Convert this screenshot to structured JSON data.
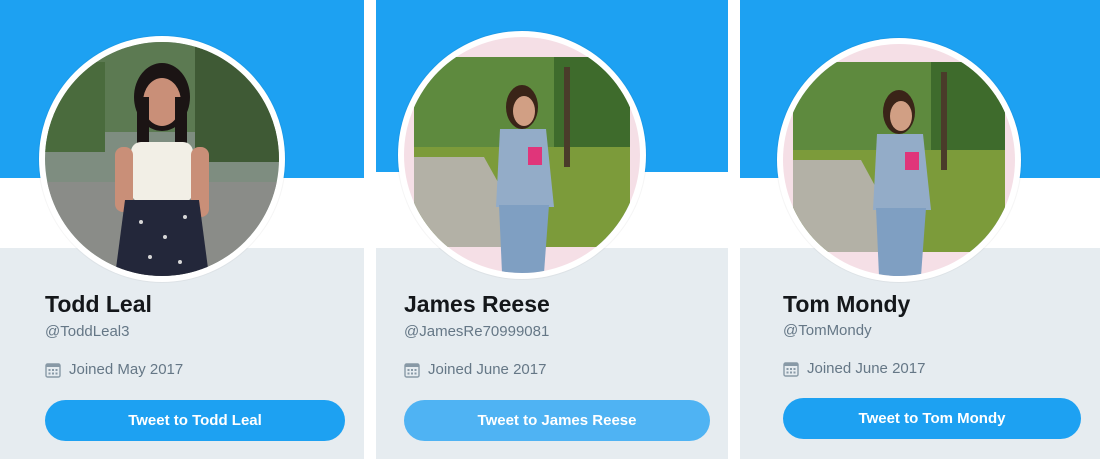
{
  "colors": {
    "banner": "#1da1f2",
    "card_bg": "#e6ecf0",
    "button": "#1da1f2",
    "button_light": "#4fb3f3",
    "name_text": "#14171a",
    "muted_text": "#657786"
  },
  "profiles": [
    {
      "name": "Todd Leal",
      "handle": "@ToddLeal3",
      "joined": "Joined May 2017",
      "joined_icon": "calendar-icon",
      "button_label": "Tweet to Todd Leal"
    },
    {
      "name": "James Reese",
      "handle": "@JamesRe70999081",
      "joined": "Joined June 2017",
      "joined_icon": "calendar-icon",
      "button_label": "Tweet to James Reese"
    },
    {
      "name": "Tom Mondy",
      "handle": "@TomMondy",
      "joined": "Joined June 2017",
      "joined_icon": "calendar-icon",
      "button_label": "Tweet to Tom Mondy"
    }
  ]
}
